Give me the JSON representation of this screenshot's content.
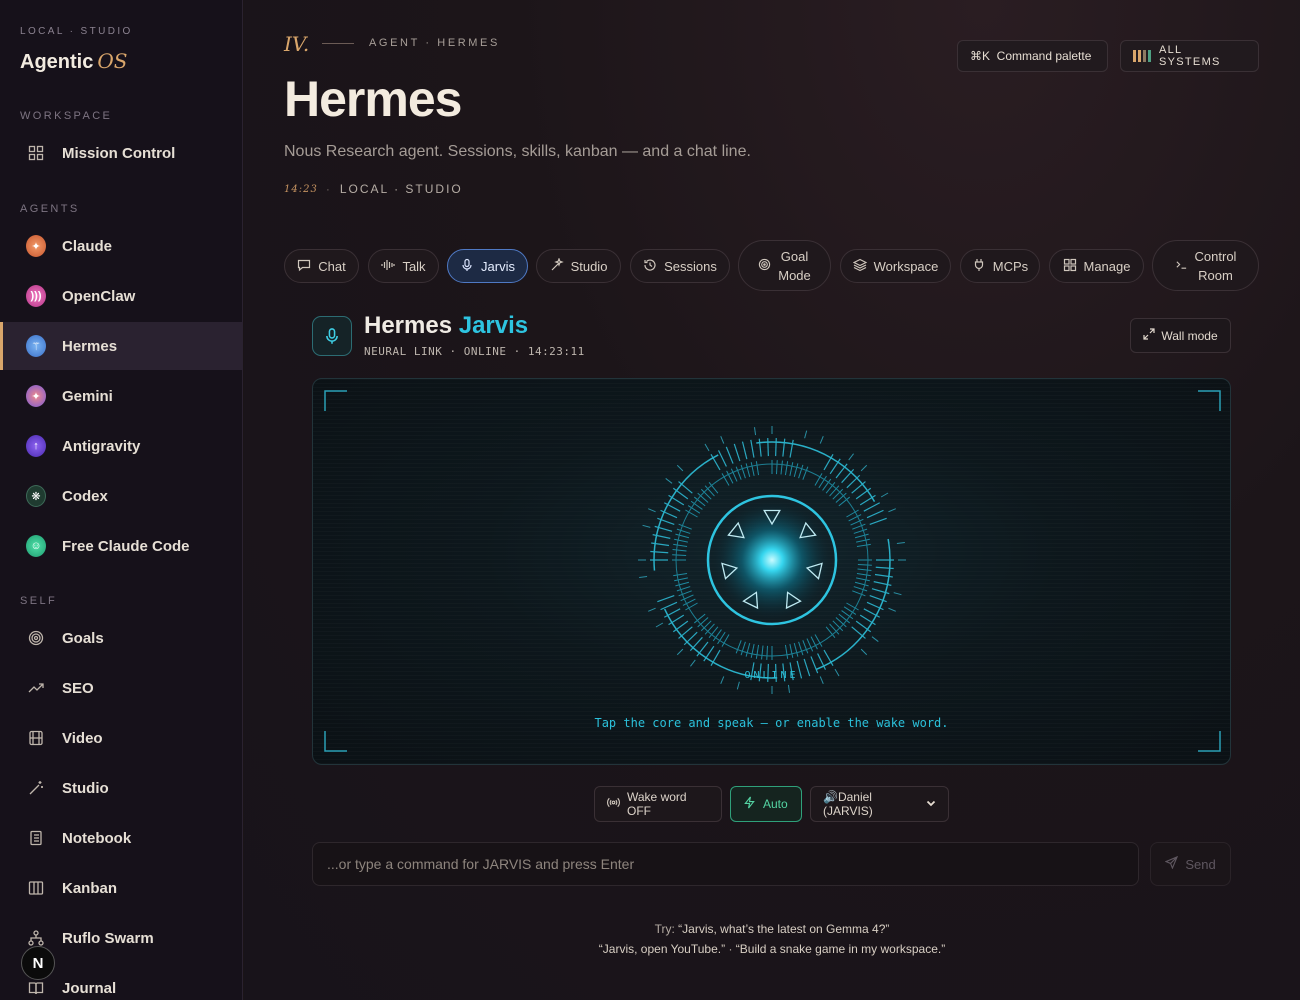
{
  "sidebar": {
    "kicker": "LOCAL · STUDIO",
    "brand": "Agentic",
    "brand_accent": "OS",
    "sections": {
      "workspace": "WORKSPACE",
      "agents": "AGENTS",
      "self": "SELF"
    },
    "workspace_items": [
      {
        "label": "Mission Control",
        "icon": "grid-icon"
      }
    ],
    "agent_items": [
      {
        "label": "Claude",
        "icon": "claude-icon",
        "color": "#e07a4f"
      },
      {
        "label": "OpenClaw",
        "icon": "openclaw-icon",
        "color": "#d64fa0"
      },
      {
        "label": "Hermes",
        "icon": "hermes-icon",
        "color": "#4f8fe0",
        "active": true
      },
      {
        "label": "Gemini",
        "icon": "gemini-icon",
        "color": "#8a6fe0"
      },
      {
        "label": "Antigravity",
        "icon": "antigravity-icon",
        "color": "#6a3fd0"
      },
      {
        "label": "Codex",
        "icon": "codex-icon",
        "color": "#1f5b45"
      },
      {
        "label": "Free Claude Code",
        "icon": "free-claude-code-icon",
        "color": "#2fbf8a"
      }
    ],
    "self_items": [
      {
        "label": "Goals",
        "icon": "target-icon"
      },
      {
        "label": "SEO",
        "icon": "trend-icon"
      },
      {
        "label": "Video",
        "icon": "film-icon"
      },
      {
        "label": "Studio",
        "icon": "wand-icon"
      },
      {
        "label": "Notebook",
        "icon": "notebook-icon"
      },
      {
        "label": "Kanban",
        "icon": "kanban-icon"
      },
      {
        "label": "Ruflo Swarm",
        "icon": "swarm-icon"
      },
      {
        "label": "Journal",
        "icon": "book-icon"
      }
    ],
    "badge": "N"
  },
  "header": {
    "roman": "IV.",
    "kicker": "AGENT · HERMES",
    "title": "Hermes",
    "subtitle": "Nous Research agent. Sessions, skills, kanban — and a chat line.",
    "time": "14:23",
    "location": "LOCAL · STUDIO",
    "command_palette": "⌘K  Command palette",
    "all_systems": "ALL SYSTEMS"
  },
  "tabs": [
    {
      "label": "Chat",
      "icon": "chat-icon"
    },
    {
      "label": "Talk",
      "icon": "waveform-icon"
    },
    {
      "label": "Jarvis",
      "icon": "mic-icon",
      "active": true
    },
    {
      "label": "Studio",
      "icon": "sparkle-icon"
    },
    {
      "label": "Sessions",
      "icon": "history-icon"
    },
    {
      "label": "Goal Mode",
      "line1": "Goal",
      "line2": "Mode",
      "icon": "target-icon"
    },
    {
      "label": "Workspace",
      "icon": "layers-icon"
    },
    {
      "label": "MCPs",
      "icon": "plug-icon"
    },
    {
      "label": "Manage",
      "icon": "manage-grid-icon"
    },
    {
      "label": "Control Room",
      "line1": "Control",
      "line2": "Room",
      "icon": "terminal-icon"
    }
  ],
  "jarvis": {
    "title_main": "Hermes",
    "title_accent": "Jarvis",
    "status": "NEURAL LINK · ONLINE · 14:23:11",
    "wall_mode": "Wall mode",
    "core_status": "ONLINE",
    "hint": "Tap the core and speak — or enable the wake word.",
    "accent_color": "#2ec4e0"
  },
  "controls": {
    "wake_word": "Wake word OFF",
    "auto": "Auto",
    "voice_selected": "🔊Daniel (JARVIS)",
    "input_placeholder": "...or type a command for JARVIS and press Enter",
    "send": "Send"
  },
  "tips": {
    "prefix": "Try: ",
    "q1": "“Jarvis, what’s the latest on Gemma 4?”",
    "q2": "“Jarvis, open YouTube.”",
    "sep": " · ",
    "q3": "“Build a snake game in my workspace.”"
  }
}
